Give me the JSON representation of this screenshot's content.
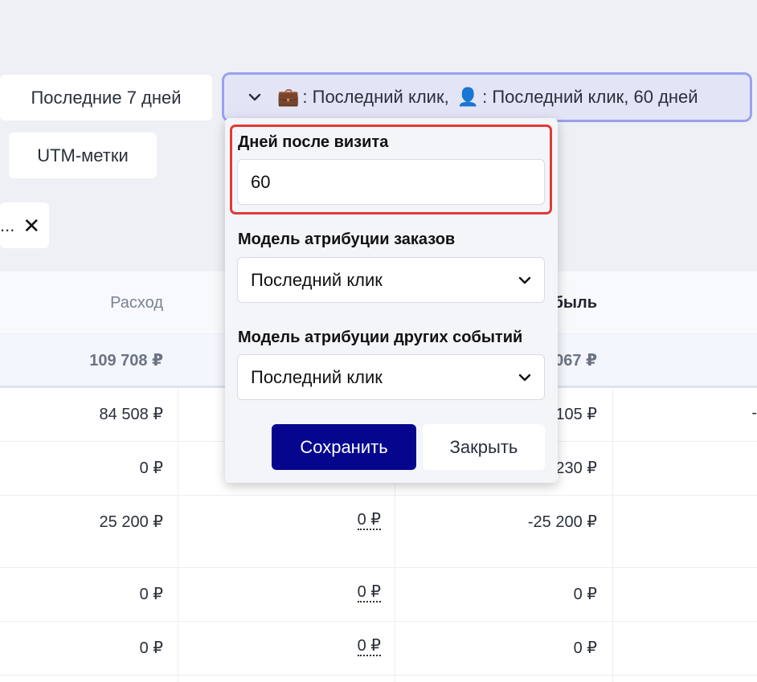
{
  "toolbar": {
    "period_label": "Последние 7 дней",
    "utm_label": "UTM-метки",
    "chip_text": "...",
    "chip_close": "✕",
    "attribution": {
      "orders_icon": "briefcase-icon",
      "orders_prefix": ": Последний клик,",
      "events_icon": "person-icon",
      "events_text": ": Последний клик, 60 дней"
    }
  },
  "table": {
    "headers": {
      "expense": "Расход",
      "profit_partial": "быль"
    },
    "total": {
      "expense": "109 708 ₽",
      "profit_partial": "067 ₽"
    },
    "rows": [
      {
        "expense": "84 508 ₽",
        "col2": "",
        "profit": "105 ₽",
        "col4": "-"
      },
      {
        "expense": "0 ₽",
        "col2": "",
        "profit": "230 ₽",
        "col4": ""
      },
      {
        "expense": "25 200 ₽",
        "col2": "0 ₽",
        "profit": "-25 200 ₽",
        "col4": ""
      },
      {
        "expense": "0 ₽",
        "col2": "0 ₽",
        "profit": "0 ₽",
        "col4": ""
      },
      {
        "expense": "0 ₽",
        "col2": "0 ₽",
        "profit": "0 ₽",
        "col4": ""
      }
    ]
  },
  "popup": {
    "days_label": "Дней после визита",
    "days_value": "60",
    "orders_model_label": "Модель атрибуции заказов",
    "orders_model_value": "Последний клик",
    "events_model_label": "Модель атрибуции других событий",
    "events_model_value": "Последний клик",
    "save_label": "Сохранить",
    "close_label": "Закрыть"
  },
  "colors": {
    "save_button": "#05058e",
    "highlight_border": "#e03a36",
    "attribution_border": "#9aa0ef"
  }
}
